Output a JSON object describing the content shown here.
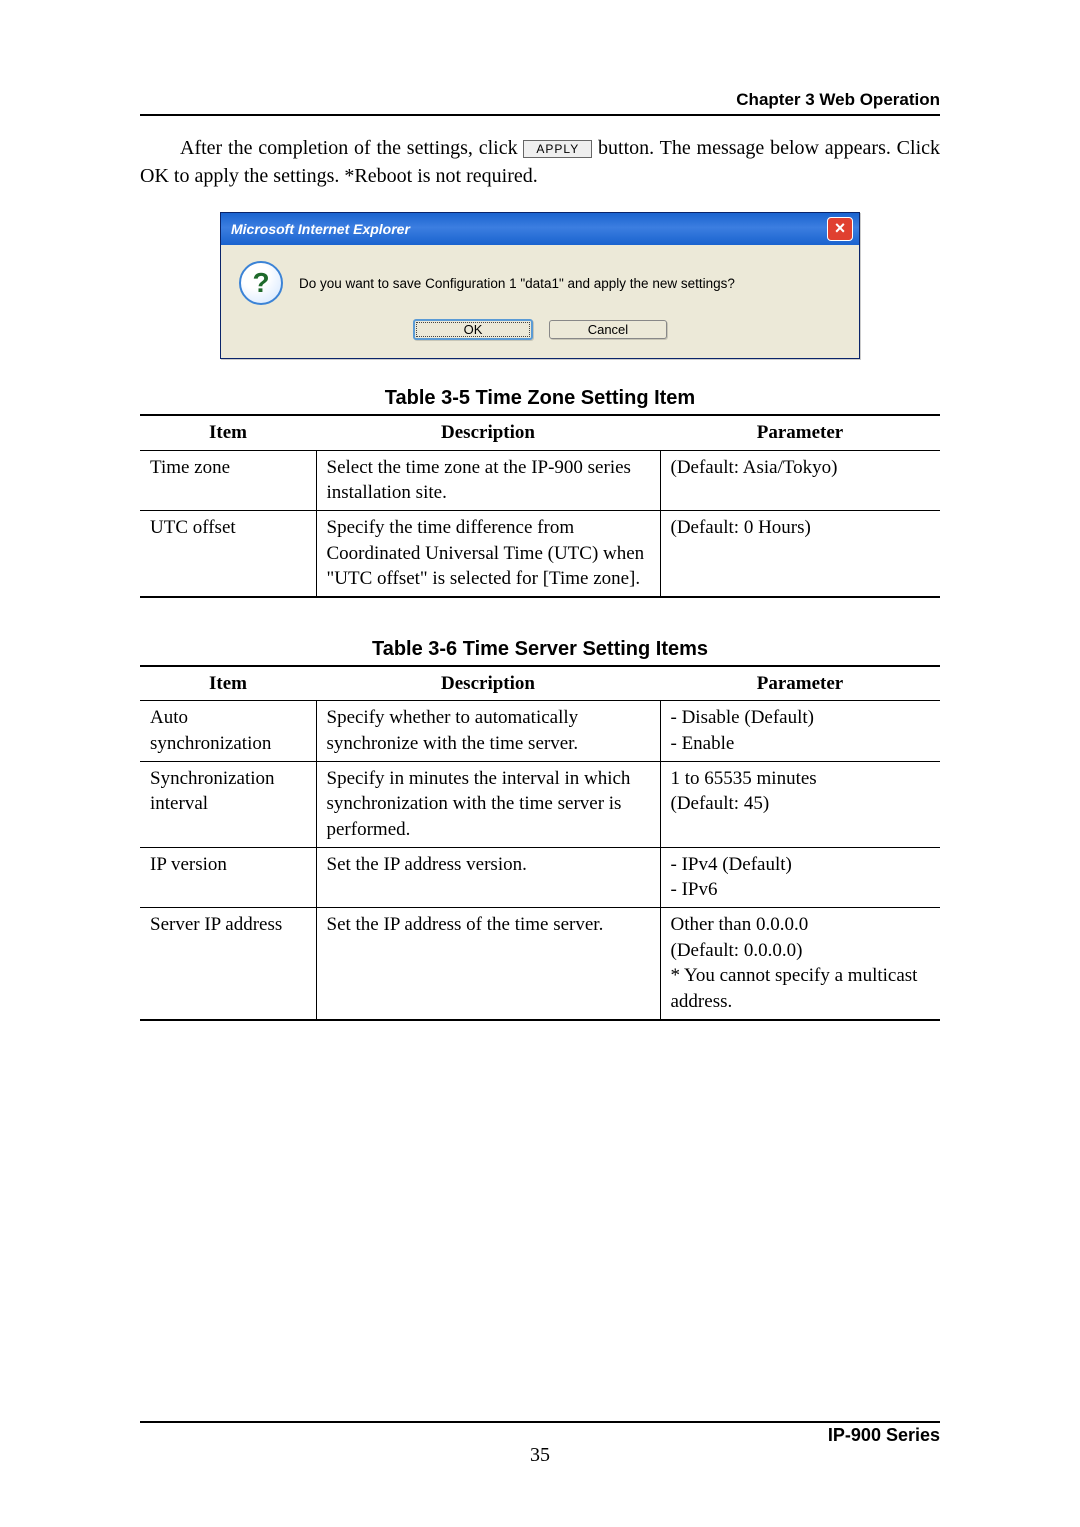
{
  "header": {
    "chapter": "Chapter 3  Web Operation"
  },
  "intro": {
    "pre": "After the completion of the settings, click ",
    "apply_label": "APPLY",
    "post": " button.  The message below appears. Click OK to apply the settings.  *Reboot is not required."
  },
  "dialog": {
    "title": "Microsoft Internet Explorer",
    "icon_glyph": "?",
    "message": "Do you want to save Configuration 1 \"data1\" and apply the new settings?",
    "ok_label": "OK",
    "cancel_label": "Cancel"
  },
  "table5": {
    "caption": "Table 3-5  Time Zone Setting Item",
    "headers": [
      "Item",
      "Description",
      "Parameter"
    ],
    "rows": [
      {
        "item": "Time zone",
        "description": "Select the time zone at the IP-900 series installation site.",
        "parameter": "(Default: Asia/Tokyo)"
      },
      {
        "item": "UTC offset",
        "description": "Specify the time difference from Coordinated Universal Time (UTC) when \"UTC offset\" is selected for [Time zone].",
        "parameter": "(Default: 0 Hours)"
      }
    ]
  },
  "table6": {
    "caption": "Table 3-6  Time Server Setting Items",
    "headers": [
      "Item",
      "Description",
      "Parameter"
    ],
    "rows": [
      {
        "item": "Auto synchronization",
        "description": "Specify whether to automatically synchronize with the time server.",
        "parameter": "- Disable (Default)\n- Enable"
      },
      {
        "item": "Synchronization interval",
        "description": "Specify in minutes the interval in which synchronization with the time server is performed.",
        "parameter": "1 to 65535 minutes\n(Default: 45)"
      },
      {
        "item": "IP version",
        "description": "Set the IP address version.",
        "parameter": "- IPv4 (Default)\n- IPv6"
      },
      {
        "item": "Server IP address",
        "description": "Set the IP address of the time server.",
        "parameter": "Other than 0.0.0.0\n(Default: 0.0.0.0)\n* You cannot specify a multicast address."
      }
    ]
  },
  "footer": {
    "series": "IP-900 Series",
    "page_number": "35"
  }
}
